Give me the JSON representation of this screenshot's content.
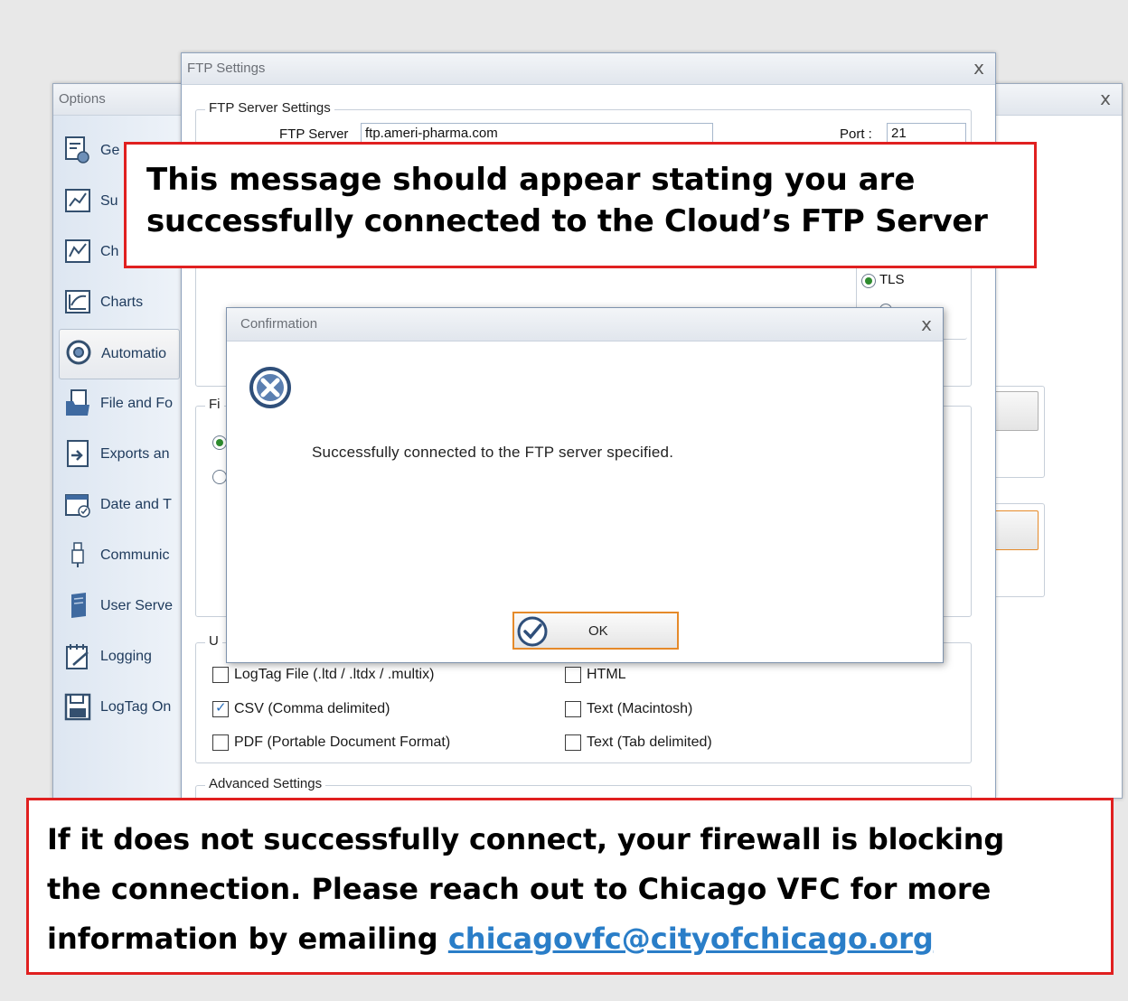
{
  "options_window": {
    "title": "Options",
    "close_glyph": "x",
    "sidebar": [
      {
        "label": "Ge",
        "icon": "general-settings-icon"
      },
      {
        "label": "Su",
        "icon": "summary-chart-icon"
      },
      {
        "label": "Ch",
        "icon": "chart-icon"
      },
      {
        "label": "Charts",
        "icon": "charts-icon"
      },
      {
        "label": "Automatio",
        "icon": "automation-icon"
      },
      {
        "label": "File and Fo",
        "icon": "file-folder-icon"
      },
      {
        "label": "Exports an",
        "icon": "export-icon"
      },
      {
        "label": "Date and T",
        "icon": "calendar-icon"
      },
      {
        "label": "Communic",
        "icon": "usb-icon"
      },
      {
        "label": "User Serve",
        "icon": "server-icon"
      },
      {
        "label": "Logging",
        "icon": "logging-icon"
      },
      {
        "label": "LogTag On",
        "icon": "save-disk-icon"
      }
    ]
  },
  "ftp_window": {
    "title": "FTP Settings",
    "close_glyph": "x",
    "server_group_label": "FTP Server Settings",
    "server_label": "FTP Server",
    "server_value": "ftp.ameri-pharma.com",
    "port_label": "Port :",
    "port_value": "21",
    "tls_label": "TLS",
    "partial_group_label": "Fi",
    "upload_group_label": "U",
    "upload_options": [
      {
        "label": "LogTag File (.ltd / .ltdx / .multix)",
        "checked": false
      },
      {
        "label": "HTML",
        "checked": false
      },
      {
        "label": "CSV (Comma delimited)",
        "checked": true
      },
      {
        "label": "Text (Macintosh)",
        "checked": false
      },
      {
        "label": "PDF (Portable Document Format)",
        "checked": false
      },
      {
        "label": "Text (Tab delimited)",
        "checked": false
      }
    ],
    "advanced_group_label": "Advanced Settings"
  },
  "confirmation_dialog": {
    "title": "Confirmation",
    "close_glyph": "x",
    "icon": "error-circle-x-icon",
    "message": "Successfully connected to the FTP server specified.",
    "ok_label": "OK",
    "ok_icon": "check-circle-icon"
  },
  "callout_top": {
    "line1": "This message should appear stating you are",
    "line2": "successfully connected to the Cloud’s FTP Server"
  },
  "callout_bottom": {
    "line1": "If it does not successfully connect, your firewall is blocking",
    "line2": "the connection. Please reach out to Chicago VFC for more",
    "line3_prefix": "information by emailing ",
    "email": "chicagovfc@cityofchicago.org"
  },
  "colors": {
    "callout_border": "#e02020",
    "link": "#2a7ec8",
    "ok_button_border": "#e58a2a"
  }
}
